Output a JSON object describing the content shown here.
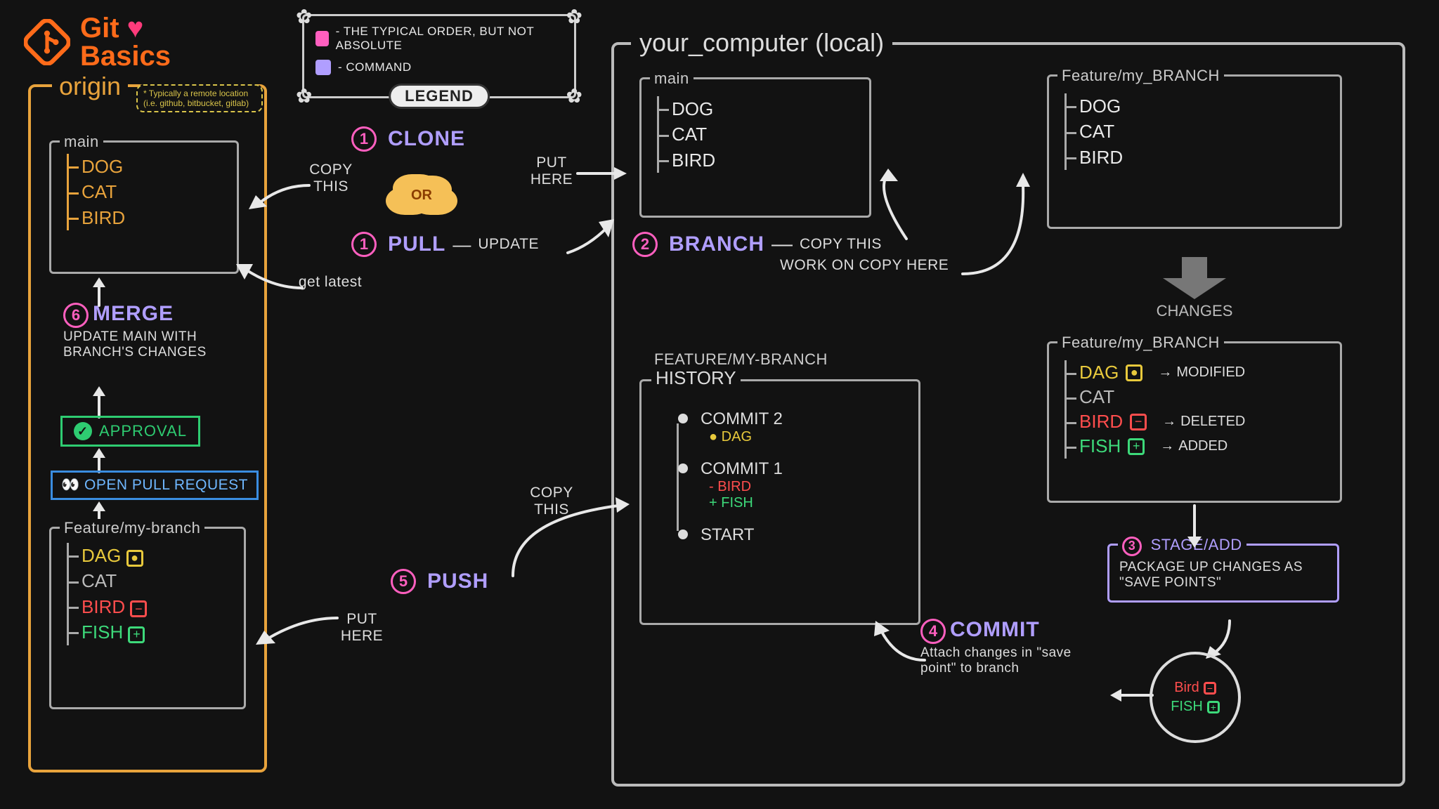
{
  "title": {
    "line1": "Git",
    "line2": "Basics",
    "heart": "♥"
  },
  "legend": {
    "badge": "LEGEND",
    "items": [
      {
        "color": "#ff5fbf",
        "text": "- THE TYPICAL ORDER, BUT NOT ABSOLUTE"
      },
      {
        "color": "#b09eff",
        "text": "- COMMAND"
      }
    ]
  },
  "origin": {
    "label": "origin",
    "note": "* Typically a remote location (i.e. github, bitbucket, gitlab)",
    "main": {
      "title": "main",
      "files": [
        "DOG",
        "CAT",
        "BIRD"
      ]
    },
    "merge": {
      "num": "6",
      "cmd": "MERGE",
      "desc": "UPDATE MAIN WITH BRANCH'S CHANGES"
    },
    "approval": "APPROVAL",
    "pr": {
      "icon": "👀",
      "text": "OPEN PULL REQUEST"
    },
    "branch": {
      "title": "Feature/my-branch",
      "files": [
        {
          "name": "DAG",
          "status": "mod",
          "glyph": "●"
        },
        {
          "name": "CAT",
          "status": "",
          "glyph": ""
        },
        {
          "name": "BIRD",
          "status": "del",
          "glyph": "−"
        },
        {
          "name": "FISH",
          "status": "add",
          "glyph": "+"
        }
      ]
    }
  },
  "local": {
    "label": "your_computer (local)",
    "main": {
      "title": "main",
      "files": [
        "DOG",
        "CAT",
        "BIRD"
      ]
    },
    "feature_initial": {
      "title": "Feature/my_BRANCH",
      "files": [
        "DOG",
        "CAT",
        "BIRD"
      ]
    },
    "changes_label": "CHANGES",
    "feature_changed": {
      "title": "Feature/my_BRANCH",
      "files": [
        {
          "name": "DAG",
          "status": "mod",
          "glyph": "●",
          "label": "MODIFIED"
        },
        {
          "name": "CAT",
          "status": "",
          "glyph": "",
          "label": ""
        },
        {
          "name": "BIRD",
          "status": "del",
          "glyph": "−",
          "label": "DELETED"
        },
        {
          "name": "FISH",
          "status": "add",
          "glyph": "+",
          "label": "ADDED"
        }
      ]
    },
    "history": {
      "title_top": "FEATURE/MY-BRANCH",
      "title": "HISTORY",
      "commits": [
        {
          "label": "COMMIT 2",
          "changes": [
            {
              "text": "DAG",
              "color": "#e8c93c",
              "prefix": "●"
            }
          ]
        },
        {
          "label": "COMMIT 1",
          "changes": [
            {
              "text": "BIRD",
              "color": "#ff4d4d",
              "prefix": "-"
            },
            {
              "text": "FISH",
              "color": "#3dd97a",
              "prefix": "+"
            }
          ]
        },
        {
          "label": "START",
          "changes": []
        }
      ]
    },
    "stage": {
      "num": "3",
      "cmd": "STAGE/ADD",
      "desc": "PACKAGE UP CHANGES AS \"SAVE POINTS\""
    },
    "commit": {
      "num": "4",
      "cmd": "COMMIT",
      "desc": "Attach changes in \"save point\" to branch"
    },
    "savepoint": [
      {
        "name": "Bird",
        "status": "del",
        "glyph": "−"
      },
      {
        "name": "FISH",
        "status": "add",
        "glyph": "+"
      }
    ]
  },
  "actions": {
    "clone": {
      "num": "1",
      "cmd": "CLONE",
      "left": "COPY THIS",
      "right": "PUT HERE"
    },
    "or": "OR",
    "pull": {
      "num": "1",
      "cmd": "PULL",
      "right": "UPDATE",
      "left": "get latest"
    },
    "branch": {
      "num": "2",
      "cmd": "BRANCH",
      "line1": "COPY THIS",
      "line2": "WORK ON COPY HERE"
    },
    "push": {
      "num": "5",
      "cmd": "PUSH",
      "right": "COPY THIS",
      "left": "PUT HERE"
    }
  }
}
